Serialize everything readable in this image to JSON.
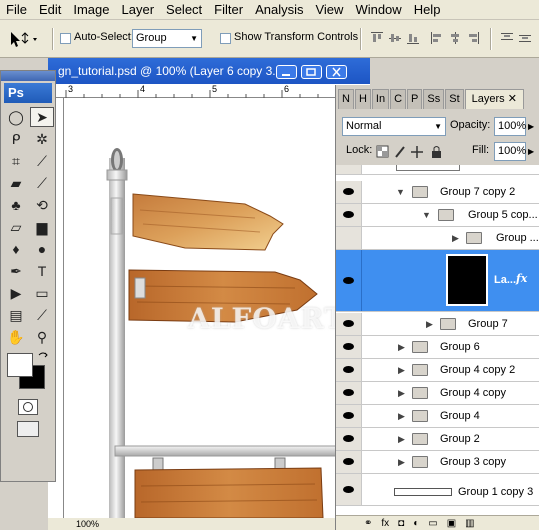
{
  "menubar": {
    "items": [
      "File",
      "Edit",
      "Image",
      "Layer",
      "Select",
      "Filter",
      "Analysis",
      "View",
      "Window",
      "Help"
    ]
  },
  "options": {
    "auto_select_label": "Auto-Select:",
    "auto_select_value": "Group",
    "show_transform_label": "Show Transform Controls"
  },
  "document": {
    "title": "gn_tutorial.psd @ 100% (Layer 6 copy 3...",
    "ruler_marks": [
      "3",
      "4",
      "5",
      "6"
    ],
    "zoom": "100%",
    "watermark": "ALFOART.COM"
  },
  "toolbox": {
    "logo": "Ps"
  },
  "layers_panel": {
    "tabs": [
      "N",
      "H",
      "In",
      "C",
      "P",
      "Ss",
      "St"
    ],
    "active_tab": "Layers",
    "blend_mode": "Normal",
    "opacity_label": "Opacity:",
    "opacity_value": "100%",
    "lock_label": "Lock:",
    "fill_label": "Fill:",
    "fill_value": "100%",
    "rows": [
      {
        "name": "Group 7 copy 2",
        "visible": true
      },
      {
        "name": "Group 5 cop...",
        "visible": true
      },
      {
        "name": "Group ...",
        "visible": false
      },
      {
        "name": "La...",
        "visible": true,
        "selected": true,
        "fx": "fx"
      },
      {
        "name": "Group 7",
        "visible": true
      },
      {
        "name": "Group 6",
        "visible": true
      },
      {
        "name": "Group 4 copy 2",
        "visible": true
      },
      {
        "name": "Group 4 copy",
        "visible": true
      },
      {
        "name": "Group 4",
        "visible": true
      },
      {
        "name": "Group 2",
        "visible": true
      },
      {
        "name": "Group 3 copy",
        "visible": true
      },
      {
        "name": "Group 1 copy 3",
        "visible": true
      }
    ]
  },
  "colors": {
    "selection": "#3f8ff0",
    "title_bar": "#2e6cd8"
  }
}
